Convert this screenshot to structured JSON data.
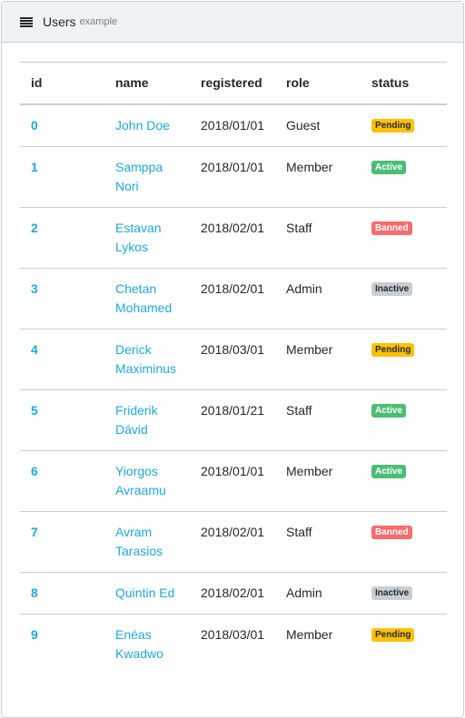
{
  "header": {
    "title": "Users",
    "subtitle": "example"
  },
  "table": {
    "columns": [
      "id",
      "name",
      "registered",
      "role",
      "status"
    ],
    "rows": [
      {
        "id": "0",
        "name": "John Doe",
        "registered": "2018/01/01",
        "role": "Guest",
        "status": "Pending",
        "status_class": "pending"
      },
      {
        "id": "1",
        "name": "Samppa Nori",
        "registered": "2018/01/01",
        "role": "Member",
        "status": "Active",
        "status_class": "active"
      },
      {
        "id": "2",
        "name": "Estavan Lykos",
        "registered": "2018/02/01",
        "role": "Staff",
        "status": "Banned",
        "status_class": "banned"
      },
      {
        "id": "3",
        "name": "Chetan Mohamed",
        "registered": "2018/02/01",
        "role": "Admin",
        "status": "Inactive",
        "status_class": "inactive"
      },
      {
        "id": "4",
        "name": "Derick Maximinus",
        "registered": "2018/03/01",
        "role": "Member",
        "status": "Pending",
        "status_class": "pending"
      },
      {
        "id": "5",
        "name": "Friderik Dávid",
        "registered": "2018/01/21",
        "role": "Staff",
        "status": "Active",
        "status_class": "active"
      },
      {
        "id": "6",
        "name": "Yiorgos Avraamu",
        "registered": "2018/01/01",
        "role": "Member",
        "status": "Active",
        "status_class": "active"
      },
      {
        "id": "7",
        "name": "Avram Tarasios",
        "registered": "2018/02/01",
        "role": "Staff",
        "status": "Banned",
        "status_class": "banned"
      },
      {
        "id": "8",
        "name": "Quintin Ed",
        "registered": "2018/02/01",
        "role": "Admin",
        "status": "Inactive",
        "status_class": "inactive"
      },
      {
        "id": "9",
        "name": "Enéas Kwadwo",
        "registered": "2018/03/01",
        "role": "Member",
        "status": "Pending",
        "status_class": "pending"
      }
    ]
  },
  "colors": {
    "link": "#20a8d8",
    "border": "#c8ced3",
    "header_bg": "#f0f3f5"
  },
  "icons": {
    "header": "hamburger-icon"
  }
}
